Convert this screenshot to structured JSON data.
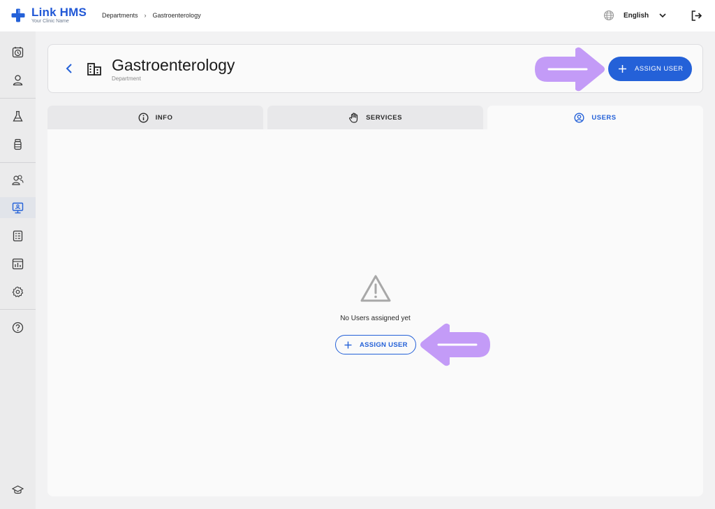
{
  "app": {
    "title": "Link HMS",
    "subtitle": "Your Clinic Name"
  },
  "breadcrumb": {
    "items": [
      "Departments",
      "Gastroenterology"
    ],
    "separator": "›"
  },
  "topbar": {
    "language": "English",
    "icons": [
      "globe-icon",
      "chevron-down-icon",
      "logout-icon"
    ]
  },
  "sidebar": {
    "items": [
      {
        "icon": "appointments-clock-icon",
        "active": false
      },
      {
        "icon": "patient-icon",
        "active": false
      },
      {
        "icon": "lab-flask-icon",
        "active": false
      },
      {
        "icon": "pharmacy-bottle-icon",
        "active": false
      },
      {
        "icon": "users-icon",
        "active": false
      },
      {
        "icon": "departments-monitor-icon",
        "active": true
      },
      {
        "icon": "reports-document-icon",
        "active": false
      },
      {
        "icon": "analytics-chart-icon",
        "active": false
      },
      {
        "icon": "settings-gear-icon",
        "active": false
      },
      {
        "icon": "help-icon",
        "active": false
      },
      {
        "icon": "academy-cap-icon",
        "active": false
      }
    ]
  },
  "header": {
    "title": "Gastroenterology",
    "subtitle": "Department",
    "assign_button_label": "ASSIGN USER"
  },
  "tabs": [
    {
      "label": "INFO",
      "icon": "info-icon",
      "active": false
    },
    {
      "label": "SERVICES",
      "icon": "hand-icon",
      "active": false
    },
    {
      "label": "USERS",
      "icon": "user-circle-icon",
      "active": true
    }
  ],
  "empty_state": {
    "icon": "warning-triangle-icon",
    "message": "No Users assigned yet",
    "button_label": "ASSIGN USER"
  },
  "colors": {
    "primary": "#2461d8",
    "annotation_arrow": "#c39bf7",
    "background": "#f2f2f3",
    "panel": "#fafafa"
  }
}
